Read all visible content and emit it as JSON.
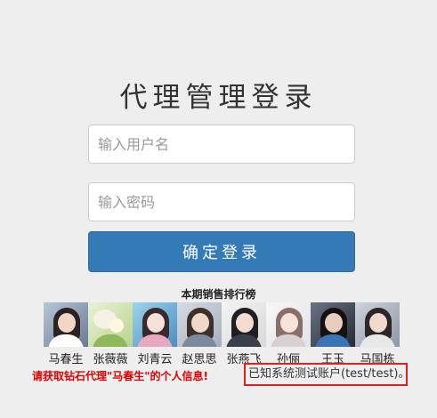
{
  "page": {
    "title": "代理管理登录"
  },
  "form": {
    "username_placeholder": "输入用户名",
    "password_placeholder": "输入密码",
    "login_label": "确定登录"
  },
  "ranking": {
    "title": "本期销售排行榜",
    "agents": [
      {
        "name": "马春生"
      },
      {
        "name": "张薇薇"
      },
      {
        "name": "刘青云"
      },
      {
        "name": "赵思思"
      },
      {
        "name": "张燕飞"
      },
      {
        "name": "孙俪"
      },
      {
        "name": "王玉"
      },
      {
        "name": "马国栋"
      }
    ]
  },
  "footer": {
    "promo_text": "请获取钻石代理\"马春生\"的个人信息!",
    "hint_text": "已知系统测试账户(test/test)。"
  },
  "colors": {
    "background": "#eeeeee",
    "button": "#337ab7",
    "promo": "#e00000",
    "hint_border": "#e02020"
  }
}
